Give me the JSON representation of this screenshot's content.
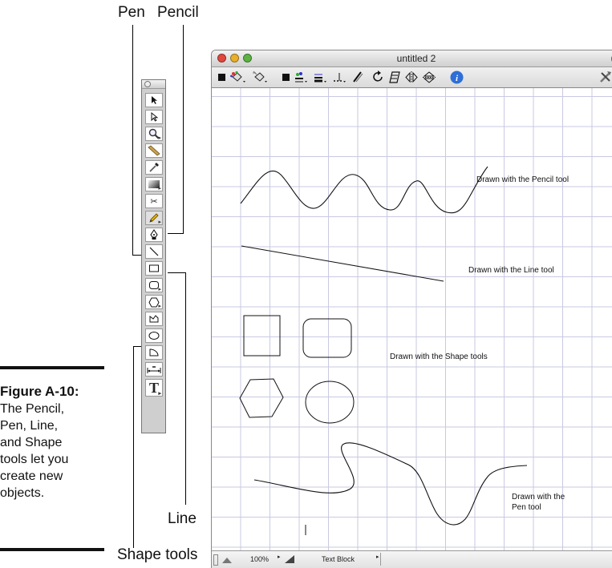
{
  "callouts": {
    "pen": "Pen",
    "pencil": "Pencil",
    "line": "Line",
    "shape_tools": "Shape tools"
  },
  "figure": {
    "title": "Figure A-10:",
    "lines": [
      "The Pencil,",
      "Pen, Line,",
      "and Shape",
      "tools let you",
      "create new",
      "objects."
    ]
  },
  "toolbox": {
    "tools": [
      "arrow-icon",
      "subselect-arrow-icon",
      "magnifier-icon",
      "ruler-icon",
      "eyedropper-icon",
      "gradient-icon",
      "scissors-icon",
      "pencil-icon",
      "pen-icon",
      "line-icon",
      "rectangle-icon",
      "rounded-rectangle-icon",
      "polygon-icon",
      "freeform-shape-icon",
      "ellipse-icon",
      "arc-icon",
      "dimension-icon",
      "text-tool-icon"
    ],
    "text_tool_label": "T"
  },
  "window": {
    "title": "untitled 2"
  },
  "canvas": {
    "annotations": {
      "pencil": "Drawn with the Pencil tool",
      "line": "Drawn with the Line tool",
      "shape": "Drawn with the Shape tools",
      "pen_line1": "Drawn with the",
      "pen_line2": "Pen tool"
    }
  },
  "statusbar": {
    "zoom": "100%",
    "mode": "Text Block"
  },
  "colors": {
    "grid": "#c9c9e2",
    "close": "#e0483e",
    "minimize": "#e9ae2c",
    "zoom": "#5bb342",
    "info": "#2f6ed6"
  }
}
